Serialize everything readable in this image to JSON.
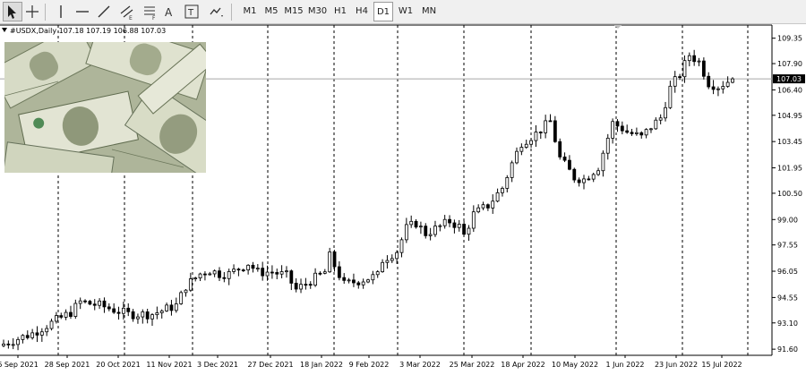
{
  "toolbar": {
    "tools": [
      {
        "name": "cursor-icon",
        "active": true
      },
      {
        "name": "crosshair-icon",
        "active": false
      },
      {
        "name": "vertical-line-icon",
        "active": false
      },
      {
        "name": "horizontal-line-icon",
        "active": false
      },
      {
        "name": "trendline-icon",
        "active": false
      },
      {
        "name": "equidistant-channel-icon",
        "active": false
      },
      {
        "name": "fibonacci-icon",
        "active": false
      },
      {
        "name": "text-icon",
        "active": false
      },
      {
        "name": "text-label-icon",
        "active": false
      },
      {
        "name": "arrow-shapes-icon",
        "active": false
      }
    ],
    "text_tool": "A",
    "label_tool": "T",
    "timeframes": [
      "M1",
      "M5",
      "M15",
      "M30",
      "H1",
      "H4",
      "D1",
      "W1",
      "MN"
    ],
    "active_timeframe": "D1"
  },
  "chart_header": {
    "symbol": "#USDX,Daily",
    "ohlc": "107.18 107.19 106.88 107.03"
  },
  "chart_data": {
    "type": "candlestick",
    "symbol": "#USDX",
    "timeframe": "Daily",
    "x_tick_labels": [
      "6 Sep 2021",
      "28 Sep 2021",
      "20 Oct 2021",
      "11 Nov 2021",
      "3 Dec 2021",
      "27 Dec 2021",
      "18 Jan 2022",
      "9 Feb 2022",
      "3 Mar 2022",
      "25 Mar 2022",
      "18 Apr 2022",
      "10 May 2022",
      "1 Jun 2022",
      "23 Jun 2022",
      "15 Jul 2022"
    ],
    "y_tick_labels": [
      "109.35",
      "107.90",
      "106.40",
      "104.95",
      "103.45",
      "101.95",
      "100.50",
      "99.00",
      "97.55",
      "96.05",
      "94.55",
      "93.10",
      "91.60"
    ],
    "y_ticks": [
      109.35,
      107.9,
      106.4,
      104.95,
      103.45,
      101.95,
      100.5,
      99.0,
      97.55,
      96.05,
      94.55,
      93.1,
      91.6
    ],
    "ylim": [
      91.25,
      110.1
    ],
    "current_price": 107.03,
    "current_price_label": "107.03",
    "close_path": [
      [
        0,
        91.9
      ],
      [
        6,
        92.5
      ],
      [
        14,
        93.7
      ],
      [
        16,
        94.3
      ],
      [
        20,
        94.1
      ],
      [
        26,
        93.6
      ],
      [
        31,
        93.6
      ],
      [
        36,
        94.1
      ],
      [
        38,
        95.2
      ],
      [
        41,
        95.9
      ],
      [
        43,
        96.1
      ],
      [
        45,
        95.9
      ],
      [
        47,
        95.9
      ],
      [
        51,
        96.5
      ],
      [
        53,
        96.0
      ],
      [
        56,
        96.0
      ],
      [
        59,
        95.8
      ],
      [
        61,
        95.0
      ],
      [
        64,
        95.5
      ],
      [
        67,
        96.0
      ],
      [
        68,
        96.9
      ],
      [
        71,
        95.3
      ],
      [
        74,
        95.5
      ],
      [
        78,
        95.8
      ],
      [
        79,
        96.7
      ],
      [
        82,
        97.2
      ],
      [
        84,
        98.5
      ],
      [
        86,
        98.8
      ],
      [
        88,
        98.2
      ],
      [
        91,
        98.6
      ],
      [
        93,
        98.9
      ],
      [
        95,
        98.6
      ],
      [
        96,
        98.1
      ],
      [
        98,
        99.3
      ],
      [
        101,
        99.8
      ],
      [
        104,
        100.8
      ],
      [
        106,
        102.2
      ],
      [
        108,
        103.4
      ],
      [
        111,
        103.9
      ],
      [
        114,
        104.6
      ],
      [
        116,
        102.5
      ],
      [
        119,
        101.4
      ],
      [
        121,
        101.3
      ],
      [
        124,
        102.0
      ],
      [
        127,
        104.5
      ],
      [
        129,
        104.2
      ],
      [
        130,
        104.0
      ],
      [
        133,
        103.7
      ],
      [
        135,
        104.3
      ],
      [
        137,
        104.8
      ],
      [
        139,
        106.5
      ],
      [
        141,
        107.3
      ],
      [
        143,
        108.4
      ],
      [
        145,
        108.0
      ],
      [
        147,
        106.8
      ],
      [
        149,
        106.6
      ],
      [
        152,
        107.03
      ]
    ]
  }
}
